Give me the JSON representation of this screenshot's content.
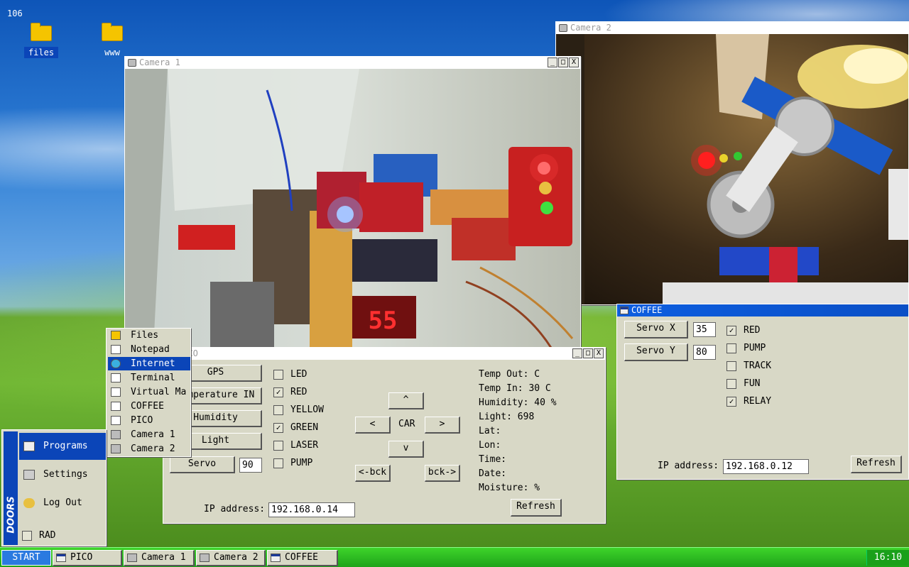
{
  "desktop": {
    "top_number": "106",
    "icons": [
      {
        "label": "files"
      },
      {
        "label": "www"
      }
    ]
  },
  "camera2": {
    "title": "Camera 2"
  },
  "camera1": {
    "title": "Camera 1",
    "display_digits": "55"
  },
  "titlebar_buttons": {
    "minimize": "_",
    "maximize": "□",
    "close": "X"
  },
  "pico": {
    "title": "PICO",
    "buttons": [
      "GPS",
      "Temperature IN",
      "Humidity",
      "Light",
      "Servo"
    ],
    "servo_value": "90",
    "checkboxes": [
      {
        "label": "LED",
        "checked": false
      },
      {
        "label": "RED",
        "checked": true
      },
      {
        "label": "YELLOW",
        "checked": false
      },
      {
        "label": "GREEN",
        "checked": true
      },
      {
        "label": "LASER",
        "checked": false
      },
      {
        "label": "PUMP",
        "checked": false
      }
    ],
    "car": {
      "up": "^",
      "left": "<",
      "center": "CAR",
      "right": ">",
      "down": "v",
      "back_left": "<-bck",
      "back_right": "bck->"
    },
    "readings": [
      "Temp Out: C",
      "Temp In: 30 C",
      "Humidity: 40 %",
      "Light:    698",
      "Lat:",
      "Lon:",
      "Time:",
      "Date:",
      "Moisture: %"
    ],
    "ip_label": "IP address:",
    "ip_value": "192.168.0.14",
    "refresh": "Refresh"
  },
  "coffee": {
    "title": "COFFEE",
    "servo_x_label": "Servo X",
    "servo_x_value": "35",
    "servo_y_label": "Servo Y",
    "servo_y_value": "80",
    "checkboxes": [
      {
        "label": "RED",
        "checked": true
      },
      {
        "label": "PUMP",
        "checked": false
      },
      {
        "label": "TRACK",
        "checked": false
      },
      {
        "label": "FUN",
        "checked": false
      },
      {
        "label": "RELAY",
        "checked": true
      }
    ],
    "ip_label": "IP address:",
    "ip_value": "192.168.0.12",
    "refresh": "Refresh"
  },
  "programs_menu": {
    "items": [
      "Files",
      "Notepad",
      "Internet",
      "Terminal",
      "Virtual Ma",
      "COFFEE",
      "PICO",
      "Camera 1",
      "Camera 2"
    ],
    "highlighted": "Internet"
  },
  "start_menu": {
    "brand": "DOORS",
    "items": [
      "Programs",
      "Settings",
      "Log Out"
    ],
    "rad_label": "RAD",
    "rad_checked": false
  },
  "taskbar": {
    "start_label": "START",
    "tasks": [
      "PICO",
      "Camera 1",
      "Camera 2",
      "COFFEE"
    ],
    "clock": "16:10"
  },
  "colors": {
    "titlebar_active": "#0d5ee0",
    "window_bg": "#d8d8c6",
    "selection": "#0b45b8",
    "taskbar": "#1ea31a"
  }
}
